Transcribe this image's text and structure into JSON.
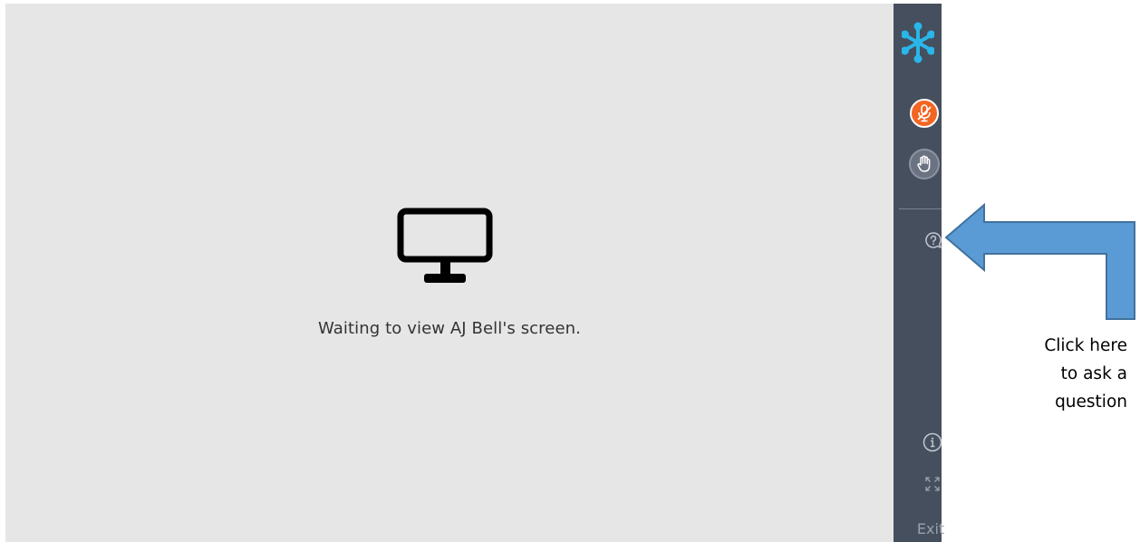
{
  "viewer": {
    "status_text": "Waiting to view AJ Bell's screen.",
    "icon": "monitor-icon",
    "background_color": "#e6e6e6"
  },
  "sidebar": {
    "background_color": "#454f5e",
    "logo_icon": "snowflake-logo-icon",
    "mic_button": {
      "icon": "mic-muted-icon",
      "color": "#f26522"
    },
    "hand_button": {
      "icon": "raise-hand-icon"
    },
    "question_button": {
      "icon": "question-bubble-icon"
    },
    "info_button": {
      "icon": "info-icon"
    },
    "fullscreen_button": {
      "icon": "expand-icon"
    },
    "exit_label": "Exit"
  },
  "annotation": {
    "arrow_color": "#5b9bd5",
    "callout_lines": [
      "Click here",
      "to ask a",
      "question"
    ]
  }
}
